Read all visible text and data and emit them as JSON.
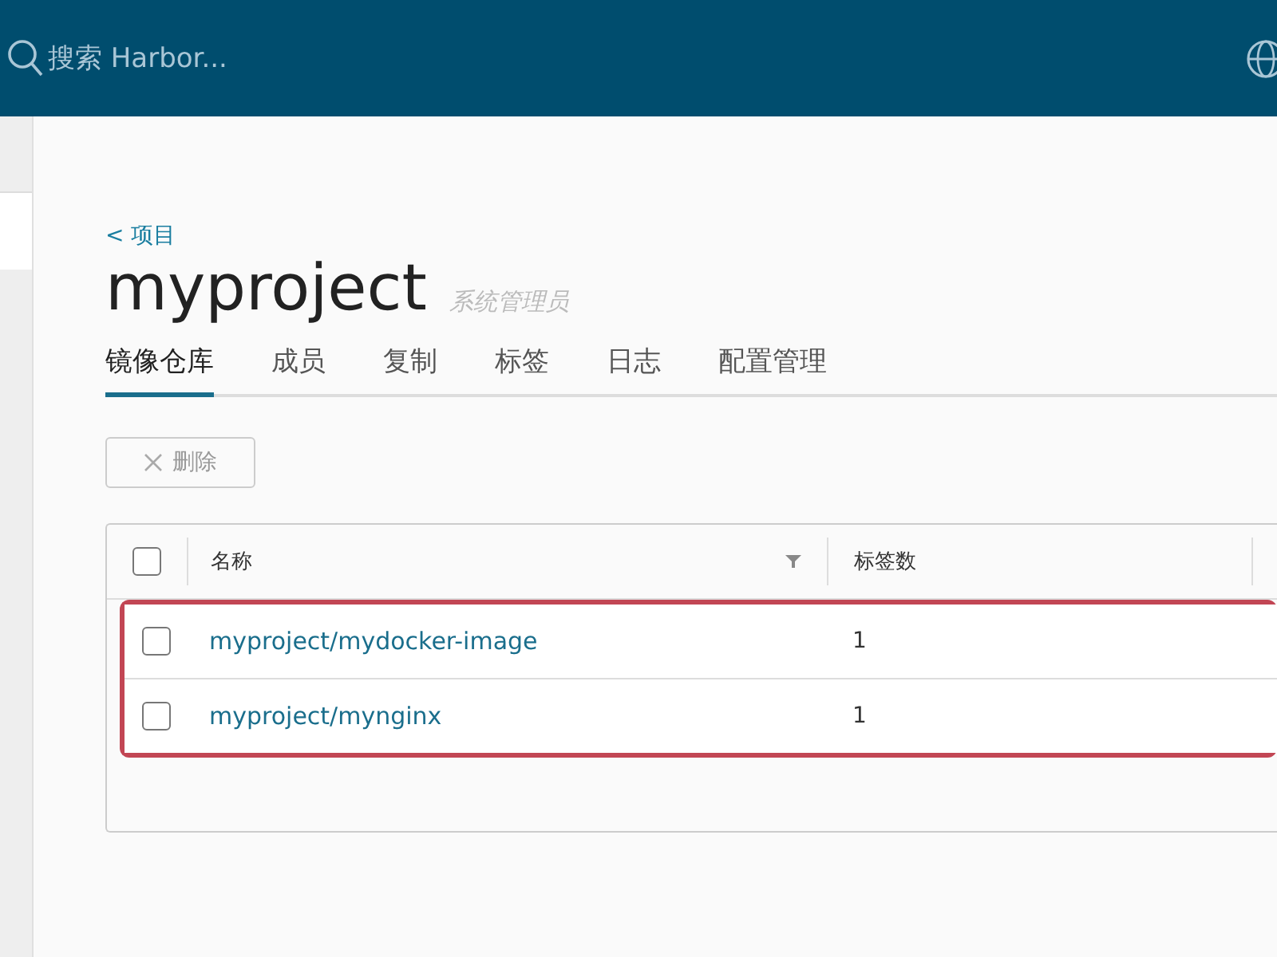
{
  "header": {
    "search": {
      "placeholder": "搜索 Harbor..."
    }
  },
  "breadcrumb": "< 项目",
  "project": {
    "title": "myproject",
    "role": "系统管理员"
  },
  "tabs": [
    {
      "label": "镜像仓库",
      "selected": true
    },
    {
      "label": "成员",
      "selected": false
    },
    {
      "label": "复制",
      "selected": false
    },
    {
      "label": "标签",
      "selected": false
    },
    {
      "label": "日志",
      "selected": false
    },
    {
      "label": "配置管理",
      "selected": false
    }
  ],
  "toolbar": {
    "delete_button": {
      "label": "删除",
      "disabled": true
    }
  },
  "table": {
    "select_all_checked": false,
    "columns": [
      "名称",
      "标签数"
    ],
    "rows_highlighted": true,
    "rows": [
      {
        "name": "myproject/mydocker-image",
        "tags": "1",
        "checked": false
      },
      {
        "name": "myproject/mynginx",
        "tags": "1",
        "checked": false
      }
    ]
  }
}
